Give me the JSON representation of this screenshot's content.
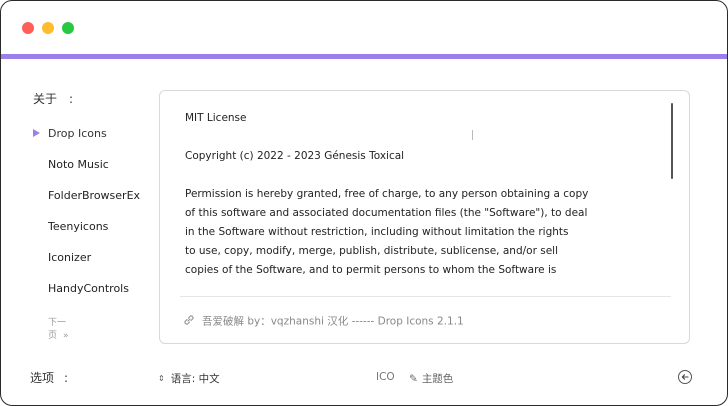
{
  "window": {
    "controls": [
      "close",
      "minimize",
      "maximize"
    ],
    "accent_color": "#9b7fea"
  },
  "about": {
    "label": "关于",
    "colon": ":"
  },
  "sidebar": {
    "items": [
      {
        "label": "Drop Icons",
        "active": true
      },
      {
        "label": "Noto Music"
      },
      {
        "label": "FolderBrowserEx"
      },
      {
        "label": "Teenyicons"
      },
      {
        "label": "Iconizer"
      },
      {
        "label": "HandyControls"
      }
    ],
    "next_page": "下一页",
    "next_page_icon": "double-chevron-right-icon"
  },
  "license": {
    "text": "MIT License\n\nCopyright (c) 2022 - 2023 Génesis Toxical\n\nPermission is hereby granted, free of charge, to any person obtaining a copy\nof this software and associated documentation files (the \"Software\"), to deal\nin the Software without restriction, including without limitation the rights\nto use, copy, modify, merge, publish, distribute, sublicense, and/or sell\ncopies of the Software, and to permit persons to whom the Software is"
  },
  "credit": {
    "icon": "link-icon",
    "text": "吾爱破解 by：vqzhanshi 汉化 ------ Drop Icons 2.1.1"
  },
  "options": {
    "label": "选项",
    "colon": ":",
    "language": "语言: 中文",
    "format": "ICO",
    "theme_color": "主题色"
  }
}
